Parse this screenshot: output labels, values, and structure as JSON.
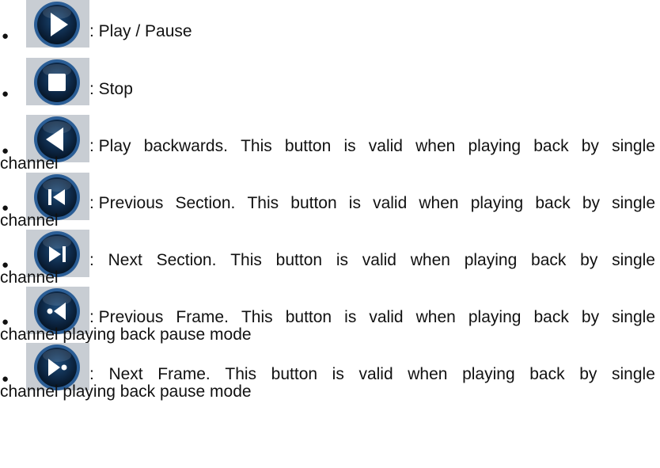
{
  "colors": {
    "button_ring": "#2b5e96",
    "button_face": "#0c2440",
    "button_glyph": "#ffffff",
    "button_backdrop": "#c8cdd3"
  },
  "items": [
    {
      "icon": "play-pause-icon",
      "line1_words": [
        ": Play / Pause"
      ],
      "line2": ""
    },
    {
      "icon": "stop-icon",
      "line1_words": [
        ": Stop"
      ],
      "line2": ""
    },
    {
      "icon": "play-backwards-icon",
      "line1_words": [
        ": Play",
        "backwards.",
        "This",
        "button",
        "is",
        "valid",
        "when",
        "playing",
        "back",
        "by",
        "single"
      ],
      "line2": "channel"
    },
    {
      "icon": "previous-section-icon",
      "line1_words": [
        ": Previous",
        "Section.",
        "This",
        "button",
        "is",
        "valid",
        "when",
        "playing",
        "back",
        "by",
        "single"
      ],
      "line2": "channel"
    },
    {
      "icon": "next-section-icon",
      "line1_words": [
        ":",
        "Next",
        "Section.",
        "This",
        "button",
        "is",
        "valid",
        "when",
        "playing",
        "back",
        "by",
        "single"
      ],
      "line2": "channel"
    },
    {
      "icon": "previous-frame-icon",
      "line1_words": [
        ": Previous",
        "Frame.",
        "This",
        "button",
        "is",
        "valid",
        "when",
        "playing",
        "back",
        "by",
        "single"
      ],
      "line2": "channel playing back pause mode"
    },
    {
      "icon": "next-frame-icon",
      "line1_words": [
        ":",
        "Next",
        "Frame.",
        "This",
        "button",
        "is",
        "valid",
        "when",
        "playing",
        "back",
        "by",
        "single"
      ],
      "line2": "channel playing back pause mode"
    }
  ]
}
